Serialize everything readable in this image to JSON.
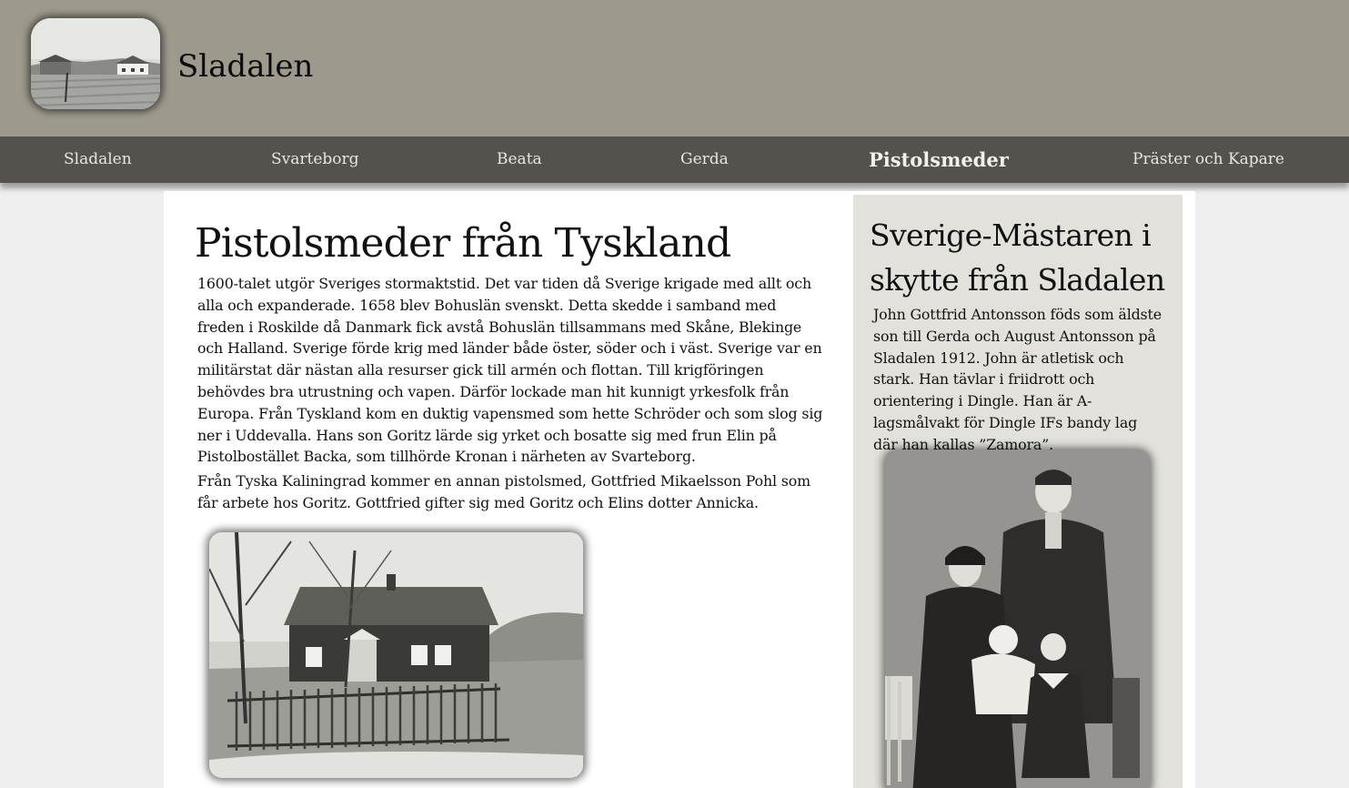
{
  "header": {
    "site_title": "Sladalen",
    "logo_icon": "farm-photo-logo"
  },
  "nav": {
    "items": [
      {
        "label": "Sladalen"
      },
      {
        "label": "Svarteborg"
      },
      {
        "label": "Beata"
      },
      {
        "label": "Gerda"
      },
      {
        "label": "Pistolsmeder",
        "active": true
      },
      {
        "label": "Präster och Kapare"
      }
    ]
  },
  "article": {
    "title": "Pistolsmeder från Tyskland",
    "paragraphs": [
      "1600-talet utgör Sveriges stormaktstid. Det var tiden då Sverige krigade med allt och alla och expanderade. 1658 blev Bohuslän svenskt. Detta skedde i samband med freden i Roskilde då Danmark fick avstå Bohuslän tillsammans med Skåne, Blekinge och Halland. Sverige förde krig med länder både öster, söder och i väst. Sverige var en militärstat där nästan alla resurser gick till armén och flottan. Till krigföringen behövdes bra utrustning och vapen. Därför lockade man hit kunnigt yrkesfolk från Europa. Från Tyskland kom en duktig vapensmed som hette Schröder och som slog sig ner i Uddevalla. Hans son Goritz lärde sig yrket och bosatte sig med frun Elin på Pistolbostället Backa, som tillhörde Kronan i närheten av Svarteborg.",
      "Från Tyska Kaliningrad kommer en annan pistolsmed, Gottfried Mikaelsson Pohl som får arbete hos Goritz. Gottfried gifter sig med Goritz och Elins dotter Annicka."
    ]
  },
  "sidebar": {
    "title": "Sverige-Mästaren i skytte från Sladalen",
    "text": "John Gottfrid Antonsson föds som äldste son till Gerda och August Antonsson på Sladalen 1912. John är atletisk och stark. Han tävlar i friidrott och orientering i Dingle. Han är A-lagsmålvakt för Dingle IFs bandy lag där han kallas ”Zamora”."
  },
  "colors": {
    "header_bg": "#9d9a8d",
    "nav_bg": "#53524d",
    "page_bg": "#efefef",
    "content_bg": "#ffffff",
    "sidebar_bg": "#e2e1dc"
  }
}
